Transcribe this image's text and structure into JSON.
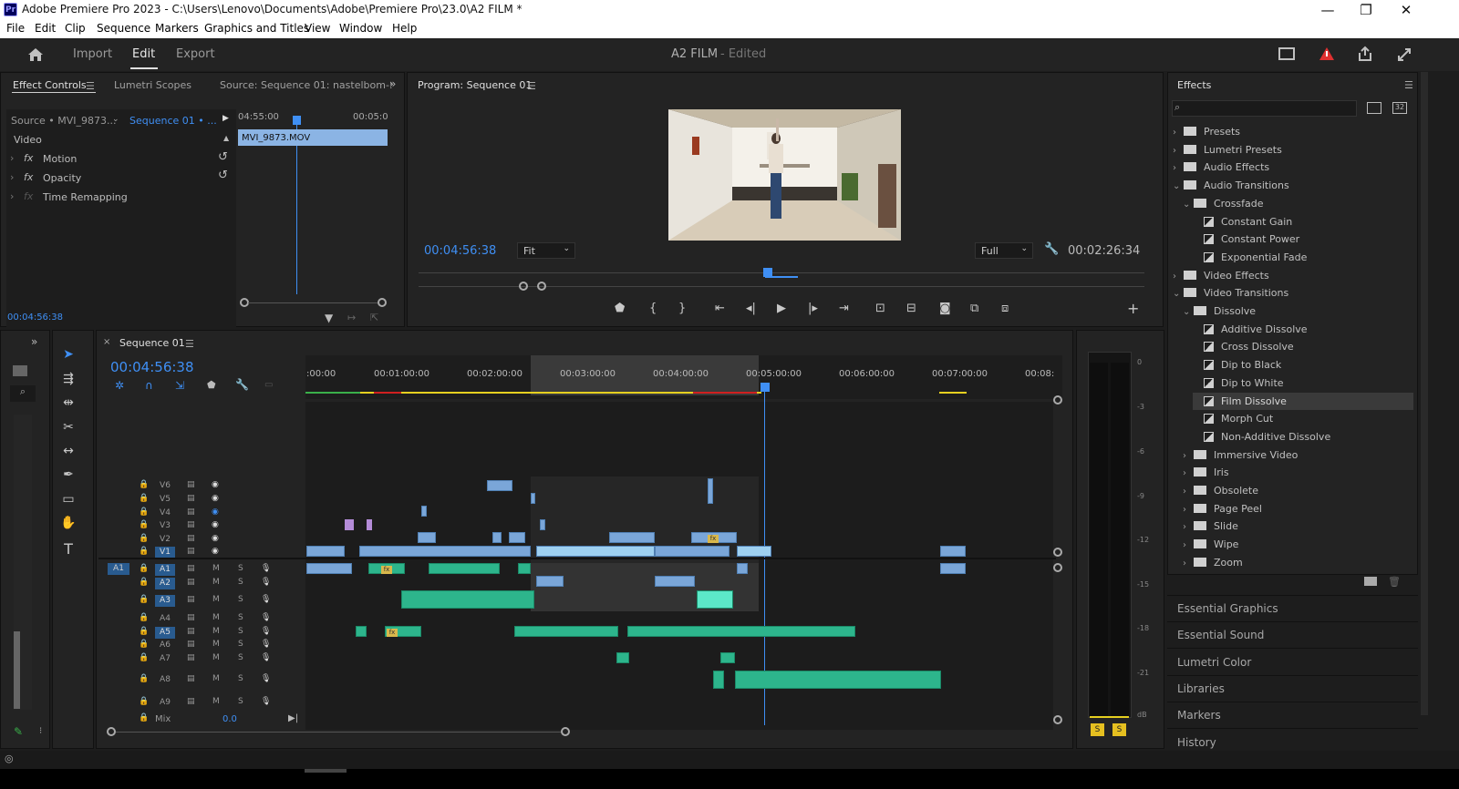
{
  "window": {
    "title": "Adobe Premiere Pro 2023 - C:\\Users\\Lenovo\\Documents\\Adobe\\Premiere Pro\\23.0\\A2 FILM *",
    "logo": "Pr",
    "minimize": "—",
    "maximize": "❐",
    "close": "✕"
  },
  "menu": [
    "File",
    "Edit",
    "Clip",
    "Sequence",
    "Markers",
    "Graphics and Titles",
    "View",
    "Window",
    "Help"
  ],
  "workspace": {
    "home_icon": "home-icon",
    "import": "Import",
    "edit": "Edit",
    "export": "Export",
    "project": "A2 FILM",
    "status": "- Edited"
  },
  "effect_controls": {
    "tabs": [
      "Effect Controls",
      "Lumetri Scopes",
      "Source: Sequence 01: nastelbom-:"
    ],
    "source": "Source • MVI_9873...",
    "sequence": "Sequence 01 • ...",
    "section": "Video",
    "rows": [
      "Motion",
      "Opacity",
      "Time Remapping"
    ],
    "tc_start": "04:55:00",
    "tc_end": "00:05:0",
    "clip": "MVI_9873.MOV",
    "timecode": "00:04:56:38"
  },
  "program": {
    "title": "Program: Sequence 01",
    "timecode": "00:04:56:38",
    "fit": "Fit",
    "quality": "Full",
    "duration": "00:02:26:34"
  },
  "timeline": {
    "title": "Sequence 01",
    "timecode": "00:04:56:38",
    "ruler": [
      ":00:00",
      "00:01:00:00",
      "00:02:00:00",
      "00:03:00:00",
      "00:04:00:00",
      "00:05:00:00",
      "00:06:00:00",
      "00:07:00:00",
      "00:08:"
    ],
    "video_tracks": [
      "V6",
      "V5",
      "V4",
      "V3",
      "V2",
      "V1"
    ],
    "audio_tracks": [
      "A1",
      "A2",
      "A3",
      "A4",
      "A5",
      "A6",
      "A7",
      "A8",
      "A9"
    ],
    "source_patch": "A1",
    "mix": "Mix",
    "mix_val": "0.0",
    "m": "M",
    "s": "S"
  },
  "meter": {
    "labels": [
      "0",
      "-3",
      "-6",
      "-9",
      "-12",
      "-15",
      "-18",
      "-21",
      "dB"
    ],
    "solo": [
      "S",
      "S"
    ]
  },
  "effects": {
    "title": "Effects",
    "tree": [
      {
        "label": "Presets",
        "level": 0,
        "kind": "folder",
        "open": false
      },
      {
        "label": "Lumetri Presets",
        "level": 0,
        "kind": "folder",
        "open": false
      },
      {
        "label": "Audio Effects",
        "level": 0,
        "kind": "folder",
        "open": false
      },
      {
        "label": "Audio Transitions",
        "level": 0,
        "kind": "folder",
        "open": true
      },
      {
        "label": "Crossfade",
        "level": 1,
        "kind": "folder",
        "open": true
      },
      {
        "label": "Constant Gain",
        "level": 2,
        "kind": "item"
      },
      {
        "label": "Constant Power",
        "level": 2,
        "kind": "item"
      },
      {
        "label": "Exponential Fade",
        "level": 2,
        "kind": "item"
      },
      {
        "label": "Video Effects",
        "level": 0,
        "kind": "folder",
        "open": false
      },
      {
        "label": "Video Transitions",
        "level": 0,
        "kind": "folder",
        "open": true
      },
      {
        "label": "Dissolve",
        "level": 1,
        "kind": "folder",
        "open": true
      },
      {
        "label": "Additive Dissolve",
        "level": 2,
        "kind": "item"
      },
      {
        "label": "Cross Dissolve",
        "level": 2,
        "kind": "item"
      },
      {
        "label": "Dip to Black",
        "level": 2,
        "kind": "item"
      },
      {
        "label": "Dip to White",
        "level": 2,
        "kind": "item"
      },
      {
        "label": "Film Dissolve",
        "level": 2,
        "kind": "item",
        "selected": true
      },
      {
        "label": "Morph Cut",
        "level": 2,
        "kind": "item"
      },
      {
        "label": "Non-Additive Dissolve",
        "level": 2,
        "kind": "item"
      },
      {
        "label": "Immersive Video",
        "level": 1,
        "kind": "folder",
        "open": false
      },
      {
        "label": "Iris",
        "level": 1,
        "kind": "folder",
        "open": false
      },
      {
        "label": "Obsolete",
        "level": 1,
        "kind": "folder",
        "open": false
      },
      {
        "label": "Page Peel",
        "level": 1,
        "kind": "folder",
        "open": false
      },
      {
        "label": "Slide",
        "level": 1,
        "kind": "folder",
        "open": false
      },
      {
        "label": "Wipe",
        "level": 1,
        "kind": "folder",
        "open": false
      },
      {
        "label": "Zoom",
        "level": 1,
        "kind": "folder",
        "open": false
      }
    ]
  },
  "side_panels": [
    "Essential Graphics",
    "Essential Sound",
    "Lumetri Color",
    "Libraries",
    "Markers",
    "History"
  ]
}
